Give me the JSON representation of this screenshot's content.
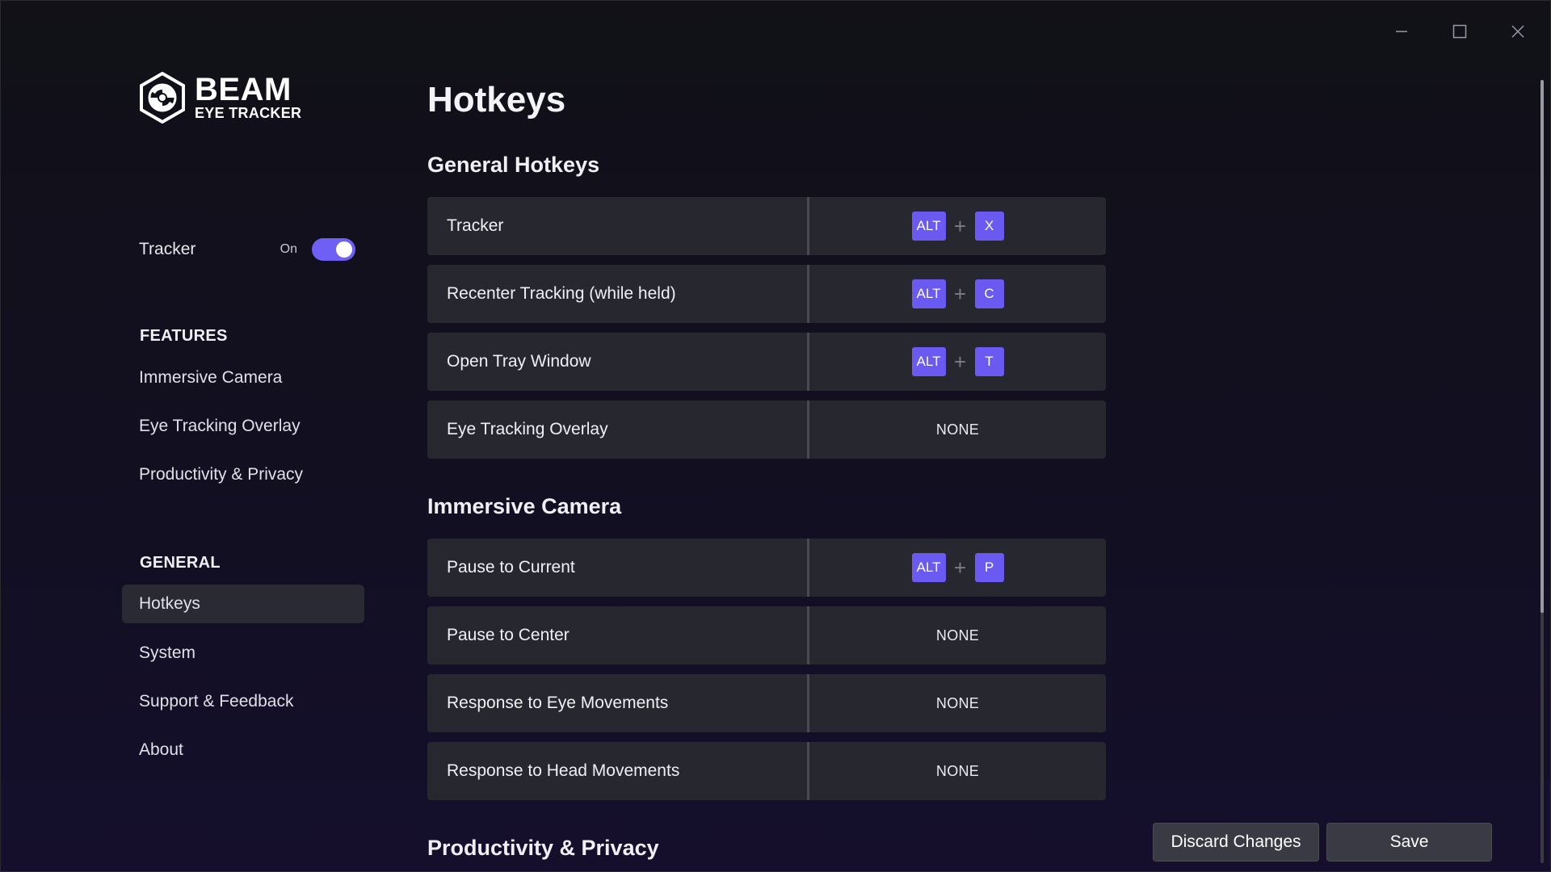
{
  "window": {
    "controls": {
      "minimize_icon": "minimize-icon",
      "maximize_icon": "maximize-icon",
      "close_icon": "close-icon"
    }
  },
  "brand": {
    "name": "BEAM",
    "subtitle": "EYE TRACKER",
    "logo_icon": "beam-logo-icon"
  },
  "tracker": {
    "label": "Tracker",
    "state": "On",
    "enabled": true
  },
  "sidebar": {
    "features_title": "FEATURES",
    "features": [
      {
        "label": "Immersive Camera"
      },
      {
        "label": "Eye Tracking Overlay"
      },
      {
        "label": "Productivity & Privacy"
      }
    ],
    "general_title": "GENERAL",
    "general": [
      {
        "label": "Hotkeys",
        "active": true
      },
      {
        "label": "System"
      },
      {
        "label": "Support & Feedback"
      },
      {
        "label": "About"
      }
    ]
  },
  "main": {
    "title": "Hotkeys",
    "groups": [
      {
        "title": "General Hotkeys",
        "rows": [
          {
            "label": "Tracker",
            "modifier": "ALT",
            "key": "X"
          },
          {
            "label": "Recenter Tracking (while held)",
            "modifier": "ALT",
            "key": "C"
          },
          {
            "label": "Open Tray Window",
            "modifier": "ALT",
            "key": "T"
          },
          {
            "label": "Eye Tracking Overlay",
            "value": "NONE"
          }
        ]
      },
      {
        "title": "Immersive Camera",
        "rows": [
          {
            "label": "Pause to Current",
            "modifier": "ALT",
            "key": "P"
          },
          {
            "label": "Pause to Center",
            "value": "NONE"
          },
          {
            "label": "Response to Eye Movements",
            "value": "NONE"
          },
          {
            "label": "Response to Head Movements",
            "value": "NONE"
          }
        ]
      },
      {
        "title": "Productivity & Privacy",
        "rows": []
      }
    ],
    "plus_symbol": "+"
  },
  "footer": {
    "discard_label": "Discard Changes",
    "save_label": "Save"
  },
  "colors": {
    "accent": "#6a5af2",
    "row_bg": "#272730",
    "button_bg": "#3a3a44"
  }
}
